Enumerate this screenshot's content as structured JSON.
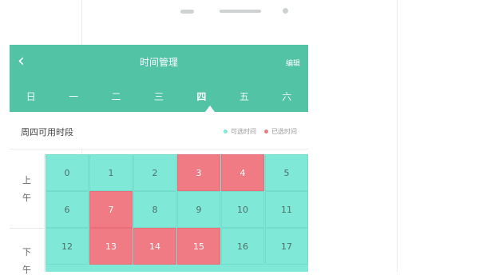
{
  "header": {
    "title": "时间管理",
    "back_icon": "‹",
    "action_label": "编辑",
    "days": [
      "日",
      "一",
      "二",
      "三",
      "四",
      "五",
      "六"
    ],
    "selected_day_index": 4
  },
  "subheader": {
    "title": "周四可用时段",
    "legend": [
      {
        "label": "可选时间",
        "color": "#7fe8d6"
      },
      {
        "label": "已选时间",
        "color": "#f07b85"
      }
    ]
  },
  "sidebar": {
    "am_label": "上\n午",
    "pm_label": "下\n午"
  },
  "grid": {
    "colors": {
      "free": "#7fe8d6",
      "used": "#f07b85"
    },
    "slots": [
      {
        "label": "0",
        "used": false
      },
      {
        "label": "1",
        "used": false
      },
      {
        "label": "2",
        "used": false
      },
      {
        "label": "3",
        "used": true
      },
      {
        "label": "4",
        "used": true
      },
      {
        "label": "5",
        "used": false
      },
      {
        "label": "6",
        "used": false
      },
      {
        "label": "7",
        "used": true
      },
      {
        "label": "8",
        "used": false
      },
      {
        "label": "9",
        "used": false
      },
      {
        "label": "10",
        "used": false
      },
      {
        "label": "11",
        "used": false
      },
      {
        "label": "12",
        "used": false
      },
      {
        "label": "13",
        "used": true
      },
      {
        "label": "14",
        "used": true
      },
      {
        "label": "15",
        "used": true
      },
      {
        "label": "16",
        "used": false
      },
      {
        "label": "17",
        "used": false
      }
    ]
  }
}
